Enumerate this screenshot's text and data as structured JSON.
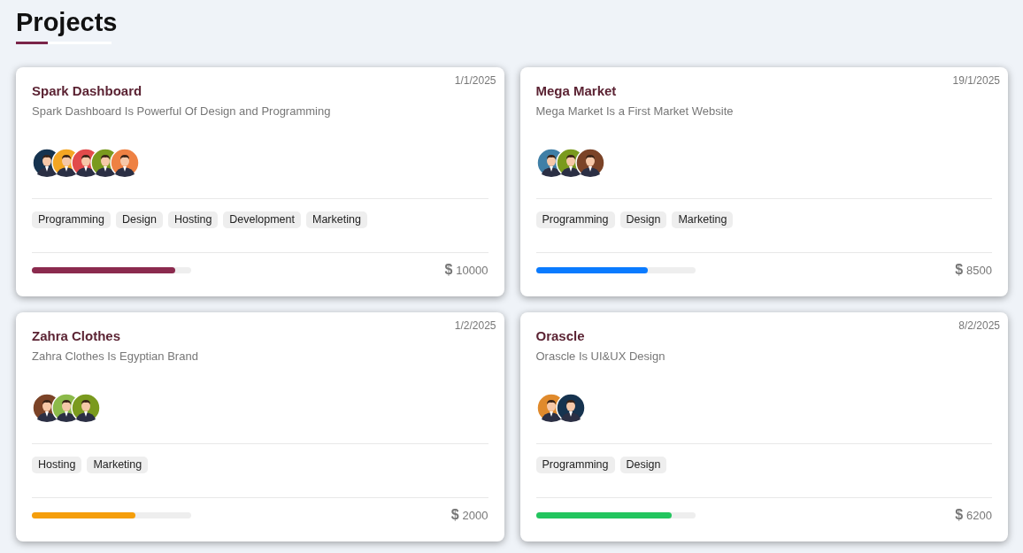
{
  "heading": "Projects",
  "projects": [
    {
      "title": "Spark Dashboard",
      "date": "1/1/2025",
      "description": "Spark Dashboard Is Powerful Of Design and Programming",
      "avatars": [
        {
          "color": "#16334f"
        },
        {
          "color": "#f4a623"
        },
        {
          "color": "#e24b4b"
        },
        {
          "color": "#7a9a1e"
        },
        {
          "color": "#ee8143"
        }
      ],
      "tags": [
        "Programming",
        "Design",
        "Hosting",
        "Development",
        "Marketing"
      ],
      "level": 0.9,
      "color": "#8b2a4e",
      "currency": "$",
      "price": "10000"
    },
    {
      "title": "Mega Market",
      "date": "19/1/2025",
      "description": "Mega Market Is a First Market Website",
      "avatars": [
        {
          "color": "#3f7fa6"
        },
        {
          "color": "#7a9a1e"
        },
        {
          "color": "#7b4327"
        }
      ],
      "tags": [
        "Programming",
        "Design",
        "Marketing"
      ],
      "level": 0.7,
      "color": "#0a7bff",
      "currency": "$",
      "price": "8500"
    },
    {
      "title": "Zahra Clothes",
      "date": "1/2/2025",
      "description": "Zahra Clothes Is Egyptian Brand",
      "avatars": [
        {
          "color": "#7b4327"
        },
        {
          "color": "#8cba4a"
        },
        {
          "color": "#7a9a1e"
        }
      ],
      "tags": [
        "Hosting",
        "Marketing"
      ],
      "level": 0.65,
      "color": "#f59e0b",
      "currency": "$",
      "price": "2000"
    },
    {
      "title": "Orascle",
      "date": "8/2/2025",
      "description": "Orascle Is UI&UX Design",
      "avatars": [
        {
          "color": "#e08a2c"
        },
        {
          "color": "#16334f"
        }
      ],
      "tags": [
        "Programming",
        "Design"
      ],
      "level": 0.85,
      "color": "#22c55e",
      "currency": "$",
      "price": "6200"
    }
  ]
}
